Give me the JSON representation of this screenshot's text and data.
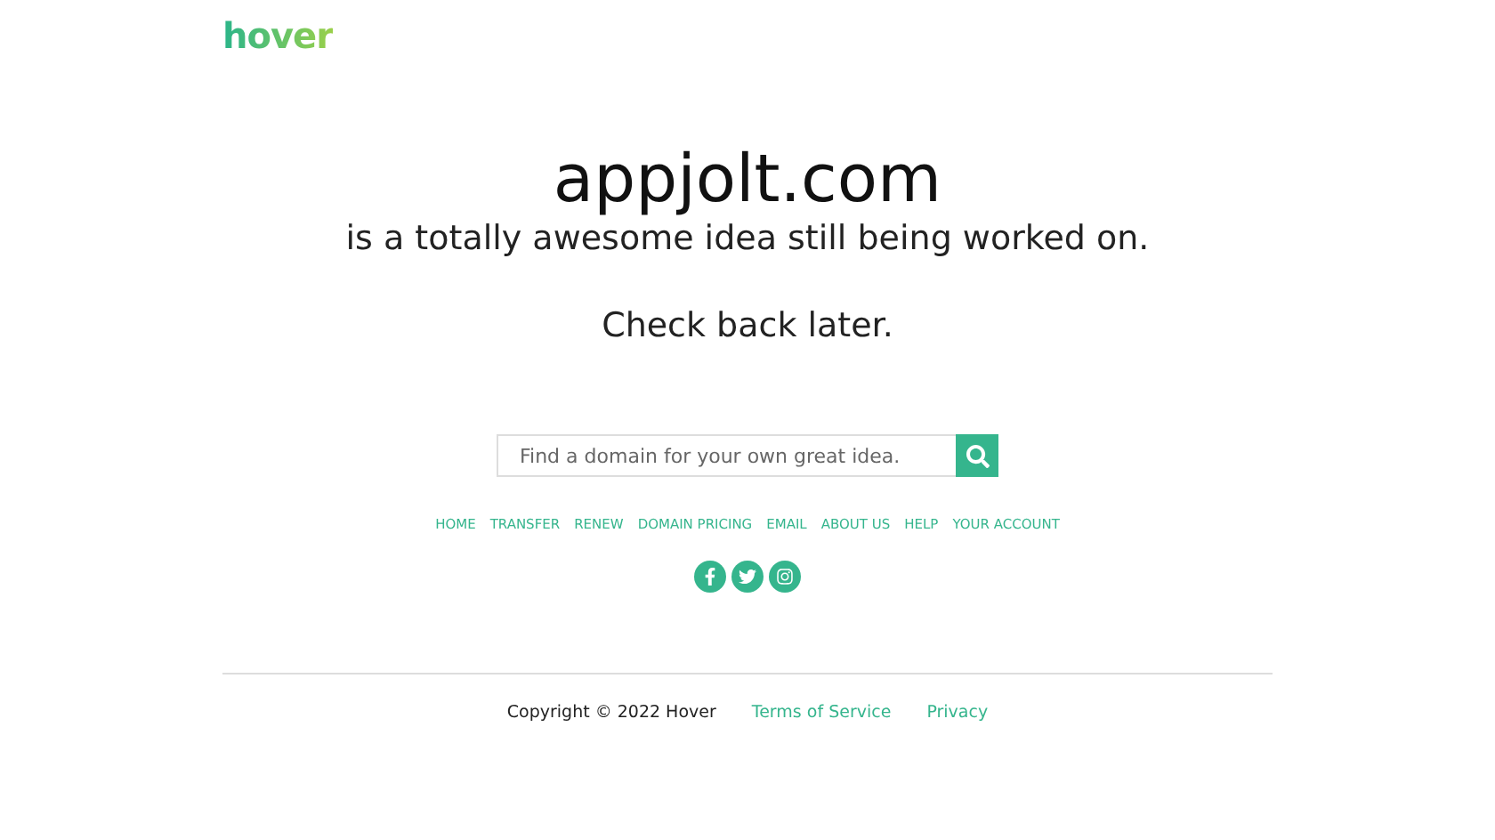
{
  "logo": "hover",
  "headline": {
    "domain": "appjolt.com",
    "tagline": "is a totally awesome idea still being worked on.",
    "note": "Check back later."
  },
  "search": {
    "placeholder": "Find a domain for your own great idea."
  },
  "nav": [
    "HOME",
    "TRANSFER",
    "RENEW",
    "DOMAIN PRICING",
    "EMAIL",
    "ABOUT US",
    "HELP",
    "YOUR ACCOUNT"
  ],
  "social": [
    {
      "kind": "facebook"
    },
    {
      "kind": "twitter"
    },
    {
      "kind": "instagram"
    }
  ],
  "footer": {
    "copyright": "Copyright © 2022 Hover",
    "links": [
      "Terms of Service",
      "Privacy"
    ]
  }
}
